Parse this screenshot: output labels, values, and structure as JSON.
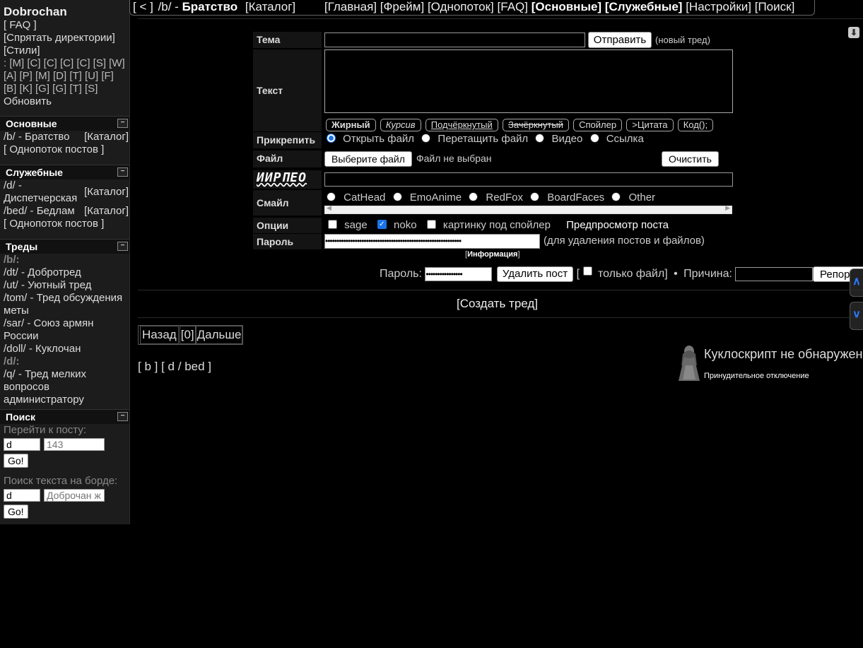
{
  "sidebar": {
    "site_name": "Dobrochan",
    "faq": "[ FAQ ]",
    "hide_dirs": "[Спрятать директории]",
    "styles": "[Стили]",
    "board_row1": ": [M] [C] [C] [C] [C] [S] [W]",
    "board_row2": "[A] [P] [M] [D] [T] [U] [F]",
    "board_row3": "[B] [K] [G] [G] [T] [S]",
    "refresh": "Обновить",
    "main_box": {
      "title": "Основные",
      "toggle": "−",
      "board": "/b/ - Братство",
      "catalog": "[Каталог]",
      "single_stream": "[ Однопоток постов ]"
    },
    "service_box": {
      "title": "Служебные",
      "toggle": "−",
      "d_board_1": "/d/ -",
      "d_board_2": "Диспетчерская",
      "d_catalog": "[Каталог]",
      "bed_board": "/bed/ - Бедлам",
      "bed_catalog": "[Каталог]",
      "single_stream": "[ Однопоток постов ]"
    },
    "threads_box": {
      "title": "Треды",
      "toggle": "−",
      "items": [
        "/b/:",
        "/dt/ - Добротред",
        "/ut/ - Уютный тред",
        "/tom/ - Тред обсуждения",
        "меты",
        "/sar/ - Союз армян",
        "России",
        "/doll/ - Куклочан",
        "/d/:",
        "/q/ - Тред мелких",
        "вопросов",
        "администратору"
      ]
    },
    "search_box": {
      "title": "Поиск",
      "toggle": "−",
      "goto_label": "Перейти к посту:",
      "goto_board_value": "d",
      "goto_post_placeholder": "143",
      "go_label": "Go!",
      "text_label": "Поиск текста на борде:",
      "text_board_value": "d",
      "text_placeholder": "Доброчан ж",
      "go2_label": "Go!"
    }
  },
  "topnav": {
    "back": "[ < ]",
    "board": "/b/ - ",
    "board_name": "Братство",
    "catalog": "[Каталог]",
    "main": "[Главная]",
    "frame": "[Фрейм]",
    "single": "[Однопоток]",
    "faq": "[FAQ]",
    "basic": "[Основные]",
    "service": "[Служебные]",
    "settings": "[Настройки]",
    "search": "[Поиск]"
  },
  "form": {
    "subject_label": "Тема",
    "submit_label": "Отправить",
    "new_thread_note": "(новый тред)",
    "text_label": "Текст",
    "markup_buttons": [
      "Жирный",
      "Курсив",
      "Подчёркнутый",
      "Зачёркнутый",
      "Спойлер",
      ">Цитата",
      "Код();"
    ],
    "attach_label": "Прикрепить",
    "attach_options": [
      "Открыть файл",
      "Перетащить файл",
      "Видео",
      "Ссылка"
    ],
    "file_label": "Файл",
    "choose_file": "Выберите файл",
    "no_file": "Файл не выбран",
    "clear": "Очистить",
    "captcha_text": "ИИРПЕО",
    "smile_label": "Смайл",
    "smile_options": [
      "CatHead",
      "EmoAnime",
      "RedFox",
      "BoardFaces",
      "Other"
    ],
    "options_label": "Опции",
    "opt_sage": "sage",
    "opt_noko": "noko",
    "opt_spoiler": "картинку под спойлер",
    "preview": "Предпросмотр поста",
    "password_label": "Пароль",
    "password_value": "••••••••••••••••••••••••••••••••••••••••••••••••••••••••••••",
    "password_note": "(для удаления постов и файлов)",
    "info": "Информация"
  },
  "delete_bar": {
    "password_label": "Пароль:",
    "password_value": "••••••••••••••••",
    "delete_label": "Удалить пост",
    "file_only": "только файл]",
    "reason_label": "Причина:",
    "report_label": "Репорт"
  },
  "create_thread": "[Создать тред]",
  "pager": {
    "prev": "Назад",
    "page": "[0]",
    "next": "Дальше"
  },
  "board_links": {
    "open": "[ ",
    "b": "b",
    "sep1": " ] [ ",
    "d": "d",
    "slash": " / ",
    "bed": "bed",
    "close": " ]"
  },
  "dollscript": {
    "title": "Куклоскрипт не обнаружен",
    "subtitle": "Принудительное отключение"
  }
}
